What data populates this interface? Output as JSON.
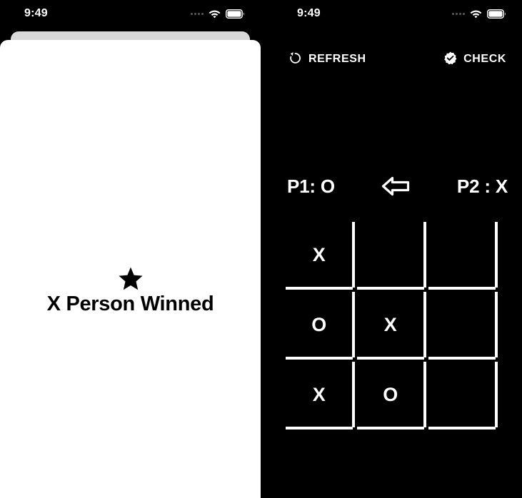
{
  "status_bar": {
    "time": "9:49",
    "signal_icon": "signal-dots-icon",
    "wifi_icon": "wifi-icon",
    "battery_icon": "battery-icon"
  },
  "colors": {
    "background": "#000000",
    "panel_light": "#ffffff",
    "sheet_back": "#d9d9d9",
    "text_on_dark": "#ffffff",
    "text_on_light": "#000000",
    "grid_line": "#ffffff"
  },
  "left_screen": {
    "name": "winner-result-screen",
    "star_icon": "star-icon",
    "star_glyph": "★",
    "winner_text": "X Person Winned"
  },
  "right_screen": {
    "name": "tic-tac-toe-game-screen",
    "actions": {
      "refresh": {
        "label": "REFRESH",
        "icon": "rotate-left-icon"
      },
      "check": {
        "label": "CHECK",
        "icon": "verified-check-icon"
      }
    },
    "players": {
      "p1_label": "P1: O",
      "p2_label": "P2 : X",
      "turn_icon": "arrow-left-icon"
    },
    "board": {
      "rows": [
        [
          {
            "mark": "X"
          },
          {
            "mark": ""
          },
          {
            "mark": ""
          }
        ],
        [
          {
            "mark": "O"
          },
          {
            "mark": "X"
          },
          {
            "mark": ""
          }
        ],
        [
          {
            "mark": "X"
          },
          {
            "mark": "O"
          },
          {
            "mark": ""
          }
        ]
      ]
    }
  }
}
